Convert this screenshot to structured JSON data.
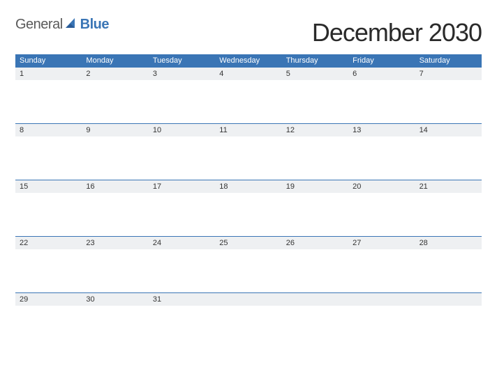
{
  "brand": {
    "part1": "General",
    "part2": "Blue"
  },
  "title": "December 2030",
  "days": [
    "Sunday",
    "Monday",
    "Tuesday",
    "Wednesday",
    "Thursday",
    "Friday",
    "Saturday"
  ],
  "weeks": [
    [
      "1",
      "2",
      "3",
      "4",
      "5",
      "6",
      "7"
    ],
    [
      "8",
      "9",
      "10",
      "11",
      "12",
      "13",
      "14"
    ],
    [
      "15",
      "16",
      "17",
      "18",
      "19",
      "20",
      "21"
    ],
    [
      "22",
      "23",
      "24",
      "25",
      "26",
      "27",
      "28"
    ],
    [
      "29",
      "30",
      "31",
      "",
      "",
      "",
      ""
    ]
  ],
  "colors": {
    "accent": "#3a75b5"
  }
}
